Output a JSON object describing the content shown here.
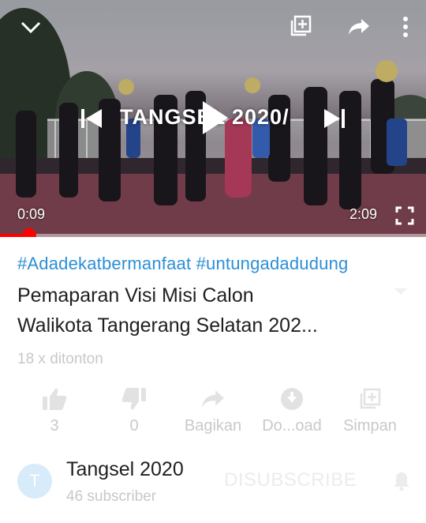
{
  "player": {
    "overlay_title": "TANGSEL 2020/",
    "current_time": "0:09",
    "duration": "2:09",
    "progress_fraction": 0.0692,
    "icons": {
      "collapse": "chevron-down-icon",
      "add_to_queue": "add-to-queue-icon",
      "share": "share-icon",
      "more": "more-vert-icon",
      "previous": "skip-previous-icon",
      "play": "play-icon",
      "next": "skip-next-icon",
      "fullscreen": "fullscreen-icon"
    }
  },
  "video": {
    "hashtags": "#Adadekatbermanfaat #untungadadudung",
    "title_line1": "Pemaparan Visi Misi Calon",
    "title_line2": "Walikota Tangerang Selatan 202...",
    "views": "18 x ditonton"
  },
  "actions": {
    "like_count": "3",
    "dislike_count": "0",
    "share_label": "Bagikan",
    "download_label": "Do...oad",
    "save_label": "Simpan"
  },
  "channel": {
    "avatar_letter": "T",
    "name": "Tangsel 2020",
    "subscribers": "46 subscriber",
    "unsubscribe_label": "DISUBSCRIBE"
  },
  "colors": {
    "accent_red": "#ff0000",
    "hashtag_blue": "#2b8fd6",
    "muted_gray": "#c8c8c8"
  }
}
